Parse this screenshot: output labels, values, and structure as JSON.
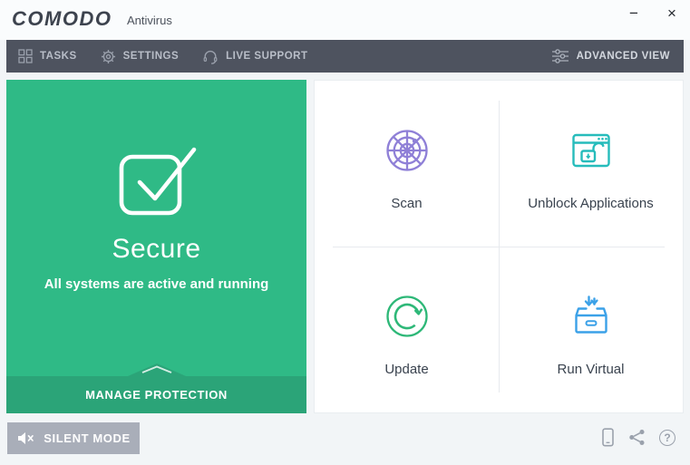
{
  "window": {
    "title_brand": "COMODO",
    "title_product": "Antivirus",
    "minimize_glyph": "−",
    "close_glyph": "×"
  },
  "toolbar": {
    "items": [
      {
        "label": "TASKS",
        "icon": "grid-icon"
      },
      {
        "label": "SETTINGS",
        "icon": "gear-icon"
      },
      {
        "label": "LIVE SUPPORT",
        "icon": "headset-icon"
      }
    ],
    "advanced_view": {
      "label": "ADVANCED VIEW",
      "icon": "sliders-icon"
    }
  },
  "status_panel": {
    "state": "Secure",
    "message": "All systems are active and running",
    "action_label": "MANAGE PROTECTION",
    "icon": "checkmark-square-icon",
    "bg_color": "#2fba86",
    "action_bg_color": "#2ba478"
  },
  "tiles": [
    {
      "label": "Scan",
      "icon": "radar-scan-icon",
      "color": "#8f80d7"
    },
    {
      "label": "Unblock Applications",
      "icon": "unlock-window-icon",
      "color": "#26bcbb"
    },
    {
      "label": "Update",
      "icon": "refresh-icon",
      "color": "#2eb878"
    },
    {
      "label": "Run Virtual",
      "icon": "virtual-box-icon",
      "color": "#3ba1e8"
    }
  ],
  "footer": {
    "silent_mode_label": "SILENT MODE",
    "silent_mode_icon": "muted-speaker-icon",
    "icons": [
      "mobile-device-icon",
      "share-icon",
      "help-icon"
    ],
    "help_glyph": "?"
  }
}
